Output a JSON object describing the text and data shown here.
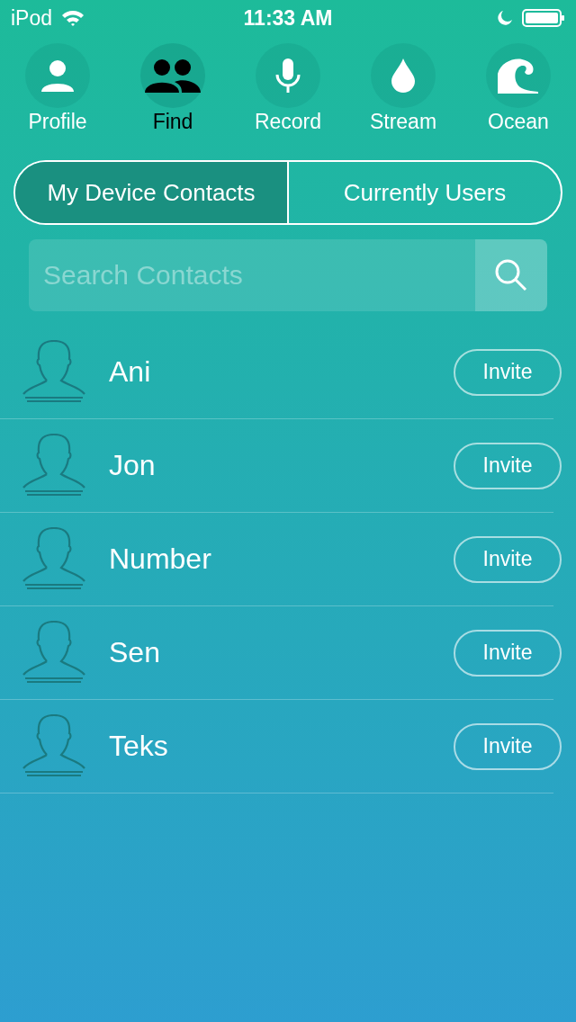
{
  "status_bar": {
    "carrier": "iPod",
    "time": "11:33 AM"
  },
  "nav": [
    {
      "kind": "person",
      "label": "Profile",
      "selected": false
    },
    {
      "kind": "group",
      "label": "Find",
      "selected": true
    },
    {
      "kind": "mic",
      "label": "Record",
      "selected": false
    },
    {
      "kind": "drop",
      "label": "Stream",
      "selected": false
    },
    {
      "kind": "wave",
      "label": "Ocean",
      "selected": false
    }
  ],
  "tabs": [
    {
      "label": "My Device Contacts",
      "selected": true
    },
    {
      "label": "Currently Users",
      "selected": false
    }
  ],
  "search": {
    "placeholder": "Search Contacts"
  },
  "contacts": [
    {
      "name": "Ani",
      "action": "Invite"
    },
    {
      "name": "Jon",
      "action": "Invite"
    },
    {
      "name": "Number",
      "action": "Invite"
    },
    {
      "name": "Sen",
      "action": "Invite"
    },
    {
      "name": "Teks",
      "action": "Invite"
    }
  ]
}
